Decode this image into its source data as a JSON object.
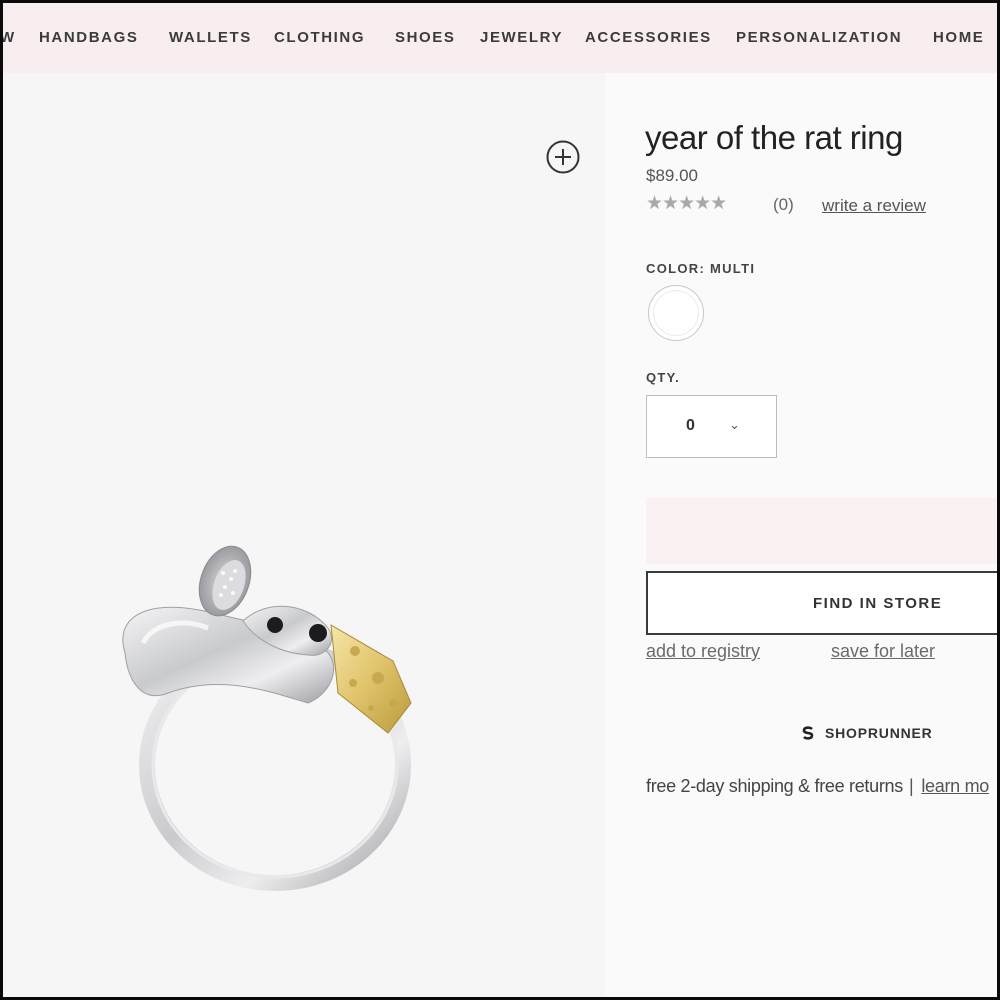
{
  "nav": {
    "items": [
      "W",
      "HANDBAGS",
      "WALLETS",
      "CLOTHING",
      "SHOES",
      "JEWELRY",
      "ACCESSORIES",
      "PERSONALIZATION",
      "HOME"
    ]
  },
  "image": {
    "zoom_icon": "plus-circle-icon",
    "ring_alt": "mouse ring with cheese"
  },
  "product": {
    "title": "year of the rat ring",
    "price": "$89.00",
    "stars": "★★★★★",
    "rating_icon": "star-rating-icon",
    "review_count": "(0)",
    "write_review": "write a review",
    "color_label": "COLOR: MULTI",
    "qty_label": "QTY.",
    "qty_value": "0",
    "qty_chevron": "⌄",
    "find_in_store": "FIND IN STORE",
    "add_to_registry": "add to registry",
    "save_for_later": "save for later",
    "shoprunner": "SHOPRUNNER",
    "shipping_text": "free 2-day shipping & free returns",
    "shipping_sep": "|",
    "learn_more": "learn mo"
  },
  "colors": {
    "nav_bg": "#f8eeef",
    "accent_pink": "#faf1f2",
    "text_dark": "#222222"
  }
}
